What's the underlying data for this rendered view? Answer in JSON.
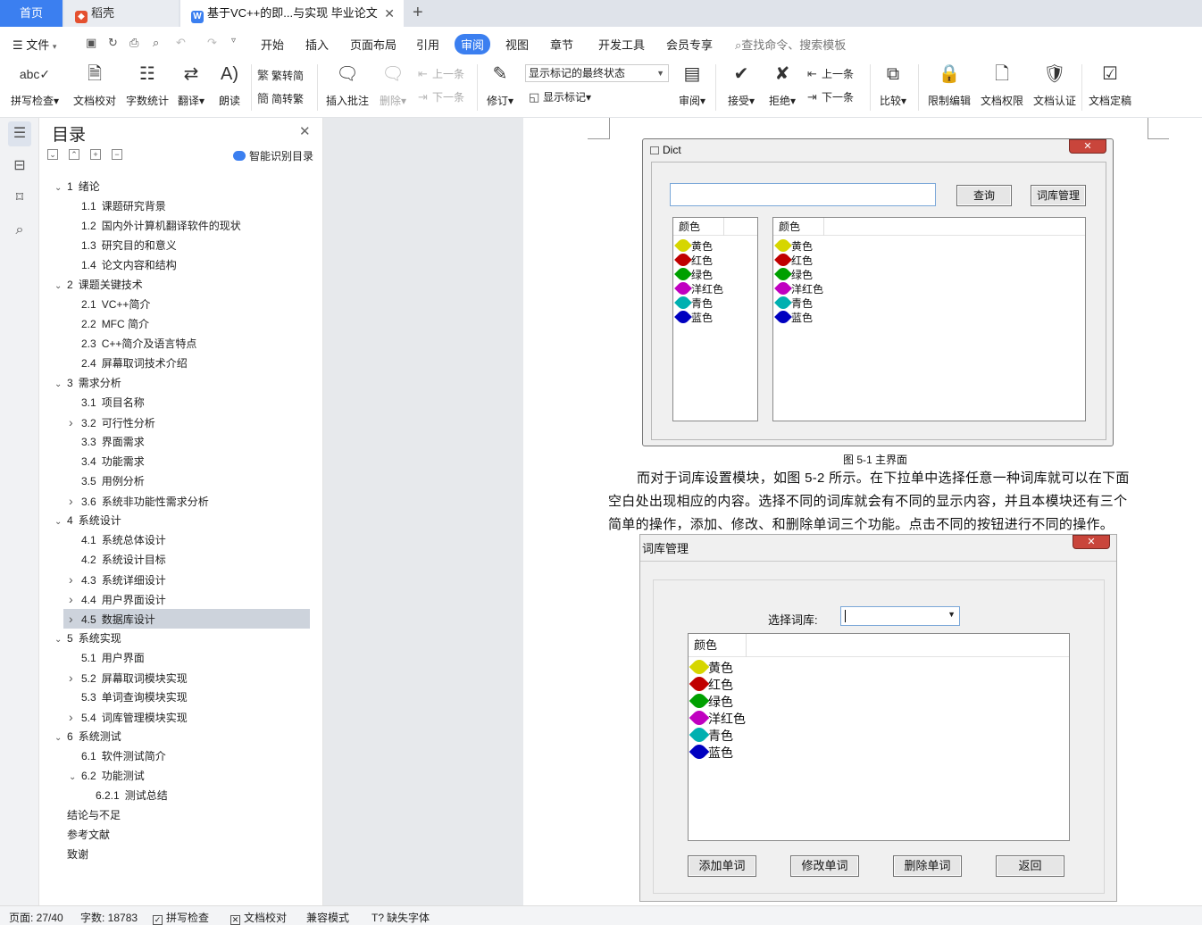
{
  "tabs": {
    "home": "首页",
    "daoke": "稻壳",
    "doc": "基于VC++的即...与实现 毕业论文",
    "close": "✕",
    "add": "+"
  },
  "menu": {
    "file": "文件",
    "items": [
      "开始",
      "插入",
      "页面布局",
      "引用",
      "审阅",
      "视图",
      "章节",
      "开发工具",
      "会员专享"
    ],
    "search": "查找命令、搜索模板"
  },
  "ribbon": {
    "spell": "拼写检查",
    "proof": "文档校对",
    "wordcount": "字数统计",
    "translate": "翻译",
    "read": "朗读",
    "trad": "繁转简",
    "simp": "简转繁",
    "insert_comment": "插入批注",
    "delete": "删除",
    "prev_c": "上一条",
    "next_c": "下一条",
    "revise": "修订",
    "mark_state": "显示标记的最终状态",
    "show_marks": "显示标记",
    "review": "审阅",
    "accept": "接受",
    "reject": "拒绝",
    "prev": "上一条",
    "next": "下一条",
    "compare": "比较",
    "restrict": "限制编辑",
    "perm": "文档权限",
    "cert": "文档认证",
    "final": "文档定稿"
  },
  "toc": {
    "title": "目录",
    "smart": "智能识别目录",
    "items": [
      {
        "num": "1",
        "text": "绪论",
        "lvl": 0,
        "arr": "v"
      },
      {
        "num": "1.1",
        "text": "课题研究背景",
        "lvl": 1,
        "arr": ""
      },
      {
        "num": "1.2",
        "text": "国内外计算机翻译软件的现状",
        "lvl": 1,
        "arr": ""
      },
      {
        "num": "1.3",
        "text": "研究目的和意义",
        "lvl": 1,
        "arr": ""
      },
      {
        "num": "1.4",
        "text": "论文内容和结构",
        "lvl": 1,
        "arr": ""
      },
      {
        "num": "2",
        "text": "课题关键技术",
        "lvl": 0,
        "arr": "v"
      },
      {
        "num": "2.1",
        "text": "VC++简介",
        "lvl": 1,
        "arr": ""
      },
      {
        "num": "2.2",
        "text": "MFC 简介",
        "lvl": 1,
        "arr": ""
      },
      {
        "num": "2.3",
        "text": "C++简介及语言特点",
        "lvl": 1,
        "arr": ""
      },
      {
        "num": "2.4",
        "text": "屏幕取词技术介绍",
        "lvl": 1,
        "arr": ""
      },
      {
        "num": "3",
        "text": "需求分析",
        "lvl": 0,
        "arr": "v"
      },
      {
        "num": "3.1",
        "text": "项目名称",
        "lvl": 1,
        "arr": ""
      },
      {
        "num": "3.2",
        "text": "可行性分析",
        "lvl": 1,
        "arr": ">"
      },
      {
        "num": "3.3",
        "text": "界面需求",
        "lvl": 1,
        "arr": ""
      },
      {
        "num": "3.4",
        "text": "功能需求",
        "lvl": 1,
        "arr": ""
      },
      {
        "num": "3.5",
        "text": "用例分析",
        "lvl": 1,
        "arr": ""
      },
      {
        "num": "3.6",
        "text": "系统非功能性需求分析",
        "lvl": 1,
        "arr": ">"
      },
      {
        "num": "4",
        "text": "系统设计",
        "lvl": 0,
        "arr": "v"
      },
      {
        "num": "4.1",
        "text": "系统总体设计",
        "lvl": 1,
        "arr": ""
      },
      {
        "num": "4.2",
        "text": "系统设计目标",
        "lvl": 1,
        "arr": ""
      },
      {
        "num": "4.3",
        "text": "系统详细设计",
        "lvl": 1,
        "arr": ">"
      },
      {
        "num": "4.4",
        "text": "用户界面设计",
        "lvl": 1,
        "arr": ">"
      },
      {
        "num": "4.5",
        "text": "数据库设计",
        "lvl": 1,
        "arr": ">"
      },
      {
        "num": "5",
        "text": "系统实现",
        "lvl": 0,
        "arr": "v"
      },
      {
        "num": "5.1",
        "text": "用户界面",
        "lvl": 1,
        "arr": ""
      },
      {
        "num": "5.2",
        "text": "屏幕取词模块实现",
        "lvl": 1,
        "arr": ">"
      },
      {
        "num": "5.3",
        "text": "单词查询模块实现",
        "lvl": 1,
        "arr": ""
      },
      {
        "num": "5.4",
        "text": "词库管理模块实现",
        "lvl": 1,
        "arr": ">"
      },
      {
        "num": "6",
        "text": "系统测试",
        "lvl": 0,
        "arr": "v"
      },
      {
        "num": "6.1",
        "text": "软件测试简介",
        "lvl": 1,
        "arr": ""
      },
      {
        "num": "6.2",
        "text": "功能测试",
        "lvl": 1,
        "arr": "v"
      },
      {
        "num": "6.2.1",
        "text": "测试总结",
        "lvl": 2,
        "arr": ""
      },
      {
        "num": "",
        "text": "结论与不足",
        "lvl": 0,
        "arr": ""
      },
      {
        "num": "",
        "text": "参考文献",
        "lvl": 0,
        "arr": ""
      },
      {
        "num": "",
        "text": "致谢",
        "lvl": 0,
        "arr": ""
      }
    ]
  },
  "dict": {
    "title": "Dict",
    "query": "查询",
    "manage": "词库管理",
    "header": "颜色"
  },
  "colors": [
    {
      "name": "黄色",
      "hex": "#d6d600"
    },
    {
      "name": "红色",
      "hex": "#c00000"
    },
    {
      "name": "绿色",
      "hex": "#00a000"
    },
    {
      "name": "洋红色",
      "hex": "#c000c0"
    },
    {
      "name": "青色",
      "hex": "#00b0b0"
    },
    {
      "name": "蓝色",
      "hex": "#0000c0"
    }
  ],
  "caption1": "图 5-1 主界面",
  "para": [
    "而对于词库设置模块，如图 5-2 所示。在下拉单中选择任意一种词库就可以在下面",
    "空白处出现相应的内容。选择不同的词库就会有不同的显示内容，并且本模块还有三个",
    "简单的操作，添加、修改、和删除单词三个功能。点击不同的按钮进行不同的操作。"
  ],
  "lib": {
    "title": "词库管理",
    "select_label": "选择词库:",
    "header": "颜色",
    "add": "添加单词",
    "modify": "修改单词",
    "delete": "删除单词",
    "back": "返回"
  },
  "status": {
    "page": "页面: 27/40",
    "words": "字数: 18783",
    "spell": "拼写检查",
    "proof": "文档校对",
    "compat": "兼容模式",
    "missing_font": "缺失字体"
  }
}
